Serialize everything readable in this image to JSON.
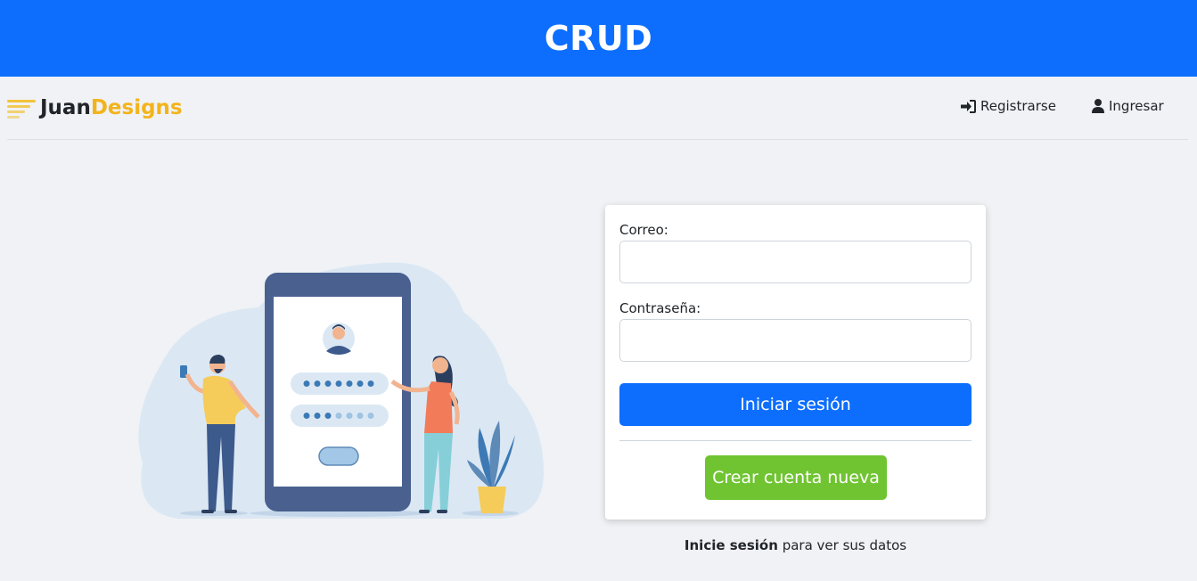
{
  "header": {
    "title": "CRUD"
  },
  "brand": {
    "part1": "Juan",
    "part2": "Designs",
    "accent_color": "#f3b41b"
  },
  "nav": {
    "register": {
      "label": "Registrarse",
      "icon": "sign-in-icon"
    },
    "login": {
      "label": "Ingresar",
      "icon": "user-icon"
    }
  },
  "form": {
    "email_label": "Correo:",
    "email_value": "",
    "password_label": "Contraseña:",
    "password_value": "",
    "submit_label": "Iniciar sesión",
    "create_label": "Crear cuenta nueva"
  },
  "footnote": {
    "bold": "Inicie sesión",
    "rest": " para ver sus datos"
  },
  "colors": {
    "primary": "#0d6efd",
    "success": "#70c432",
    "background": "#f0f2f5"
  }
}
